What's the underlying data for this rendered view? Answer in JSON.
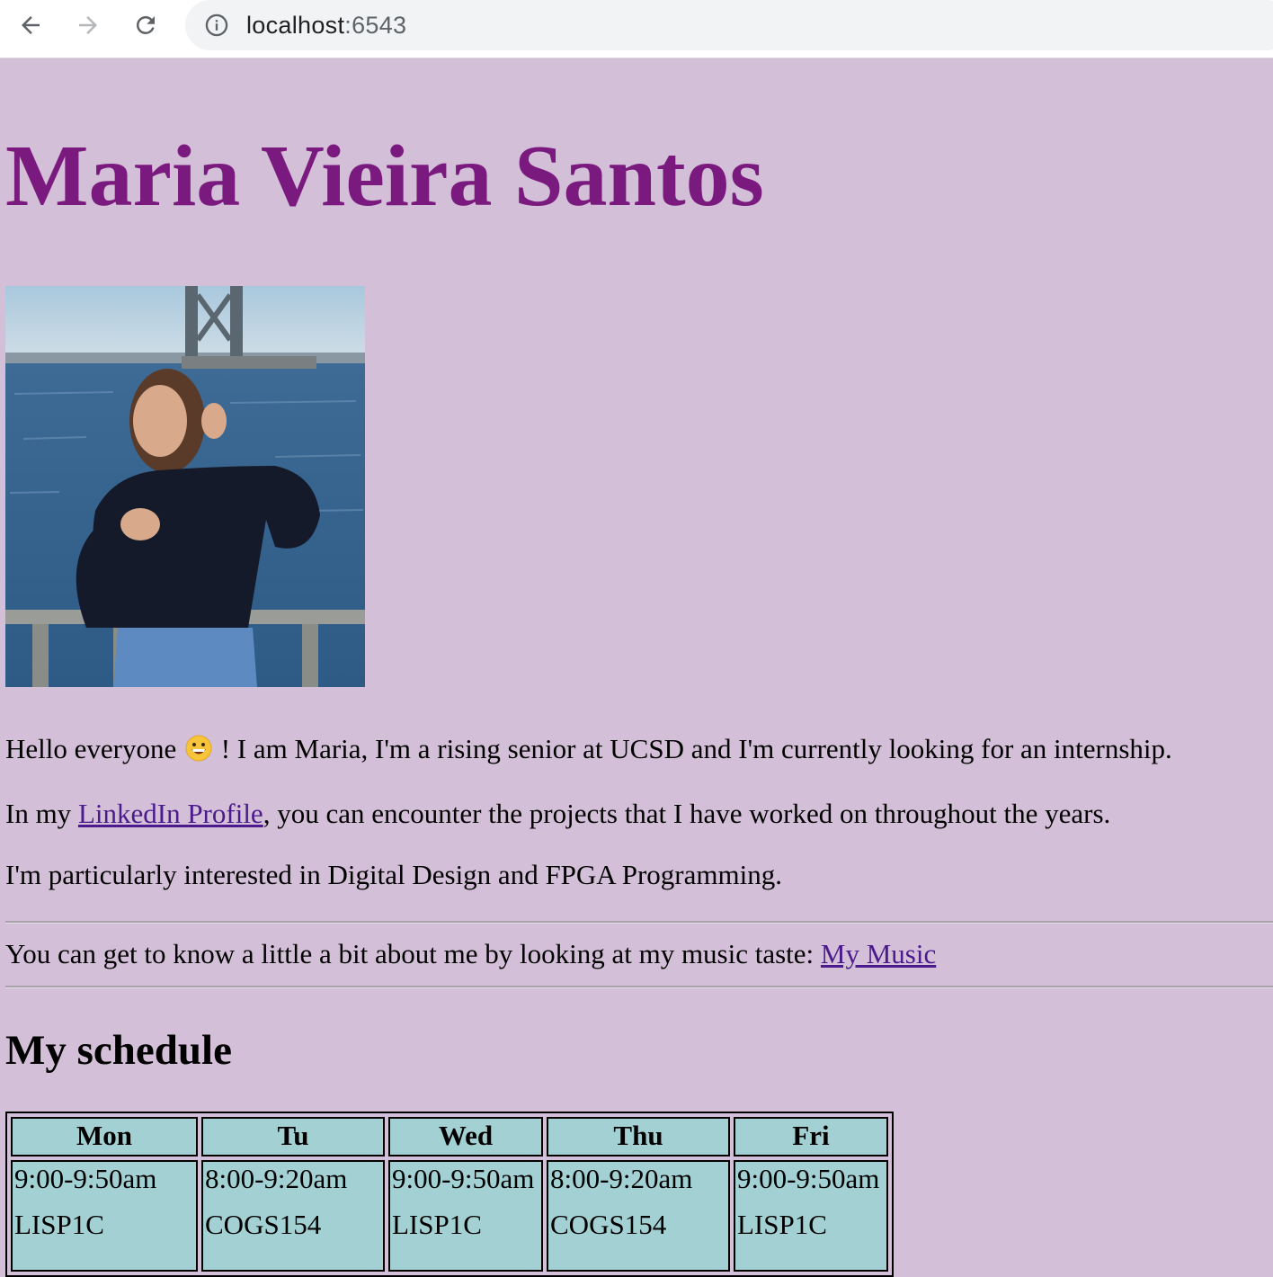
{
  "browser": {
    "url_host": "localhost",
    "url_port": ":6543",
    "icons": [
      "back-arrow-icon",
      "forward-arrow-icon",
      "reload-icon",
      "info-icon"
    ]
  },
  "profile": {
    "name": "Maria Vieira Santos",
    "name_color": "#7a1a7e",
    "background_color": "#d4bfd8"
  },
  "intro": {
    "p1_before": "Hello everyone ",
    "p1_emoji": "😄",
    "p1_after": " ! I am Maria, I'm a rising senior at UCSD and I'm currently looking for an internship.",
    "p2_before": "In my ",
    "p2_link": "LinkedIn Profile",
    "p2_after": ", you can encounter the projects that I have worked on throughout the years.",
    "p3": "I'm particularly interested in Digital Design and FPGA Programming.",
    "p4_before": "You can get to know a little a bit about me by looking at my music taste: ",
    "p4_link": "My Music"
  },
  "schedule": {
    "title": "My schedule",
    "cell_color": "#a3d1d3",
    "headers": [
      "Mon",
      "Tu",
      "Wed",
      "Thu",
      "Fri"
    ],
    "row1": [
      {
        "time": "9:00-9:50am",
        "course": "LISP1C"
      },
      {
        "time": "8:00-9:20am",
        "course": "COGS154"
      },
      {
        "time": "9:00-9:50am",
        "course": "LISP1C"
      },
      {
        "time": "8:00-9:20am",
        "course": "COGS154"
      },
      {
        "time": "9:00-9:50am",
        "course": "LISP1C"
      }
    ]
  }
}
